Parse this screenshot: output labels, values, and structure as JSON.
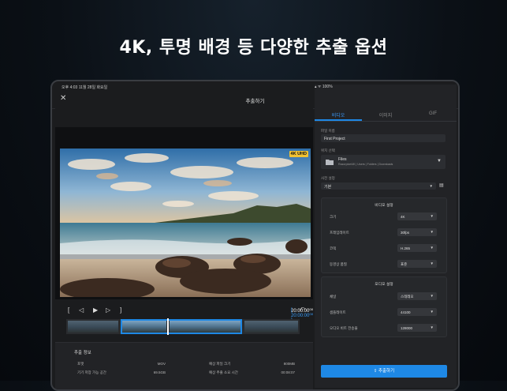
{
  "headline": "4K, 투명 배경 등 다양한 추출 옵션",
  "status": {
    "time": "오후 4:03  11월 28일 화요일",
    "right": "▴ ᯤ 100%"
  },
  "dialog": {
    "title": "추출하기",
    "close_glyph": "✕"
  },
  "preview": {
    "badge": "4K UHD"
  },
  "controls": {
    "trim_start": "[",
    "prev": "◁",
    "play": "▶",
    "next": "▷",
    "trim_end": "]",
    "time_current": "20:00:00⁰⁰",
    "time_total": "[ 20:00:00⁰⁰ ]",
    "undo": "⤺"
  },
  "info": {
    "heading": "추출 정보",
    "rows": [
      {
        "label": "포맷",
        "value": "MOV"
      },
      {
        "label": "예상 파일 크기",
        "value": "800MB"
      },
      {
        "label": "기기 저장 가능 공간",
        "value": "69.5GB"
      },
      {
        "label": "예상 추출 소요 시간",
        "value": "00:08:07"
      }
    ]
  },
  "tabs": [
    "비디오",
    "이미지",
    "GIF"
  ],
  "settings": {
    "filename_label": "파일 이름",
    "filename_value": "First Project",
    "location_label": "위치 선택",
    "location_name": "Files",
    "location_path": "Razorpixel4K | Users | Folders | Downloads",
    "preset_label": "사전 설정",
    "preset_value": "기본"
  },
  "video_settings": {
    "title": "비디오 설정",
    "rows": [
      {
        "label": "크기",
        "value": "4K"
      },
      {
        "label": "프레임레이트",
        "value": "30fps"
      },
      {
        "label": "코덱",
        "value": "H.265"
      },
      {
        "label": "동영상 품질",
        "value": "표준"
      }
    ]
  },
  "audio_settings": {
    "title": "오디오 설정",
    "rows": [
      {
        "label": "채널",
        "value": "스테레오"
      },
      {
        "label": "샘플레이트",
        "value": "44100"
      },
      {
        "label": "오디오 비트 전송율",
        "value": "128000"
      }
    ]
  },
  "export_button": "⇪ 추출하기",
  "colors": {
    "accent": "#1e88e5",
    "badge": "#f1c232",
    "background": "#0b1016"
  }
}
